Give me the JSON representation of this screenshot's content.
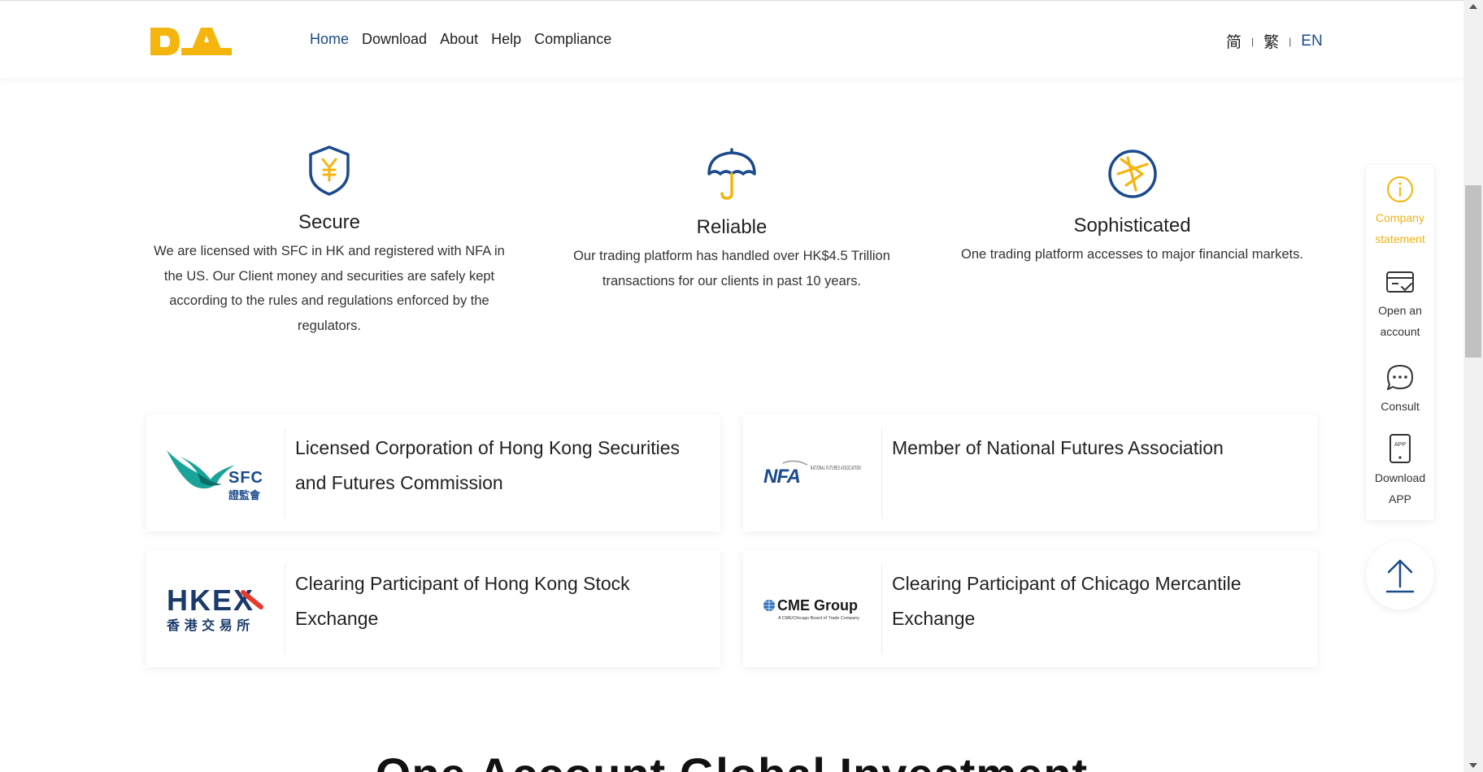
{
  "colors": {
    "brand_yellow": "#f5b50f",
    "brand_blue": "#1a4b8c",
    "text": "#222222"
  },
  "header": {
    "logo_text": "DA",
    "nav": [
      {
        "label": "Home",
        "active": true
      },
      {
        "label": "Download"
      },
      {
        "label": "About"
      },
      {
        "label": "Help"
      },
      {
        "label": "Compliance"
      }
    ],
    "lang": {
      "simplified": "简",
      "traditional": "繁",
      "english": "EN",
      "separator": "|"
    }
  },
  "features": [
    {
      "icon": "shield-yen-icon",
      "title": "Secure",
      "text": "We are licensed with SFC in HK and registered with NFA in the US. Our Client money and securities are safely kept according to the rules and regulations enforced by the regulators."
    },
    {
      "icon": "umbrella-icon",
      "title": "Reliable",
      "text": "Our trading platform has handled over HK$4.5 Trillion transactions for our clients in past 10 years."
    },
    {
      "icon": "compass-arrow-icon",
      "title": "Sophisticated",
      "text": "One trading platform accesses to major financial markets."
    }
  ],
  "cards": [
    {
      "logo": "sfc-logo",
      "logo_text": "SFC",
      "logo_sub": "證監會",
      "text": "Licensed Corporation of Hong Kong Securities and Futures Commission"
    },
    {
      "logo": "nfa-logo",
      "logo_text": "NFA",
      "logo_sub": "NATIONAL FUTURES ASSOCIATION",
      "text": "Member of National Futures Association"
    },
    {
      "logo": "hkex-logo",
      "logo_text": "HKEX",
      "logo_sub": "香 港 交 易 所",
      "text": "Clearing Participant of Hong Kong Stock Exchange"
    },
    {
      "logo": "cme-logo",
      "logo_text": "CME Group",
      "logo_sub": "A CME/Chicago Board of Trade Company",
      "text": "Clearing Participant of Chicago Mercantile Exchange"
    }
  ],
  "bottom_title": "One Account Global Investment",
  "side": {
    "company_1": "Company",
    "company_2": "statement",
    "open_1": "Open an",
    "open_2": "account",
    "consult": "Consult",
    "download_1": "Download",
    "download_2": "APP",
    "app_icon_text": "APP"
  }
}
